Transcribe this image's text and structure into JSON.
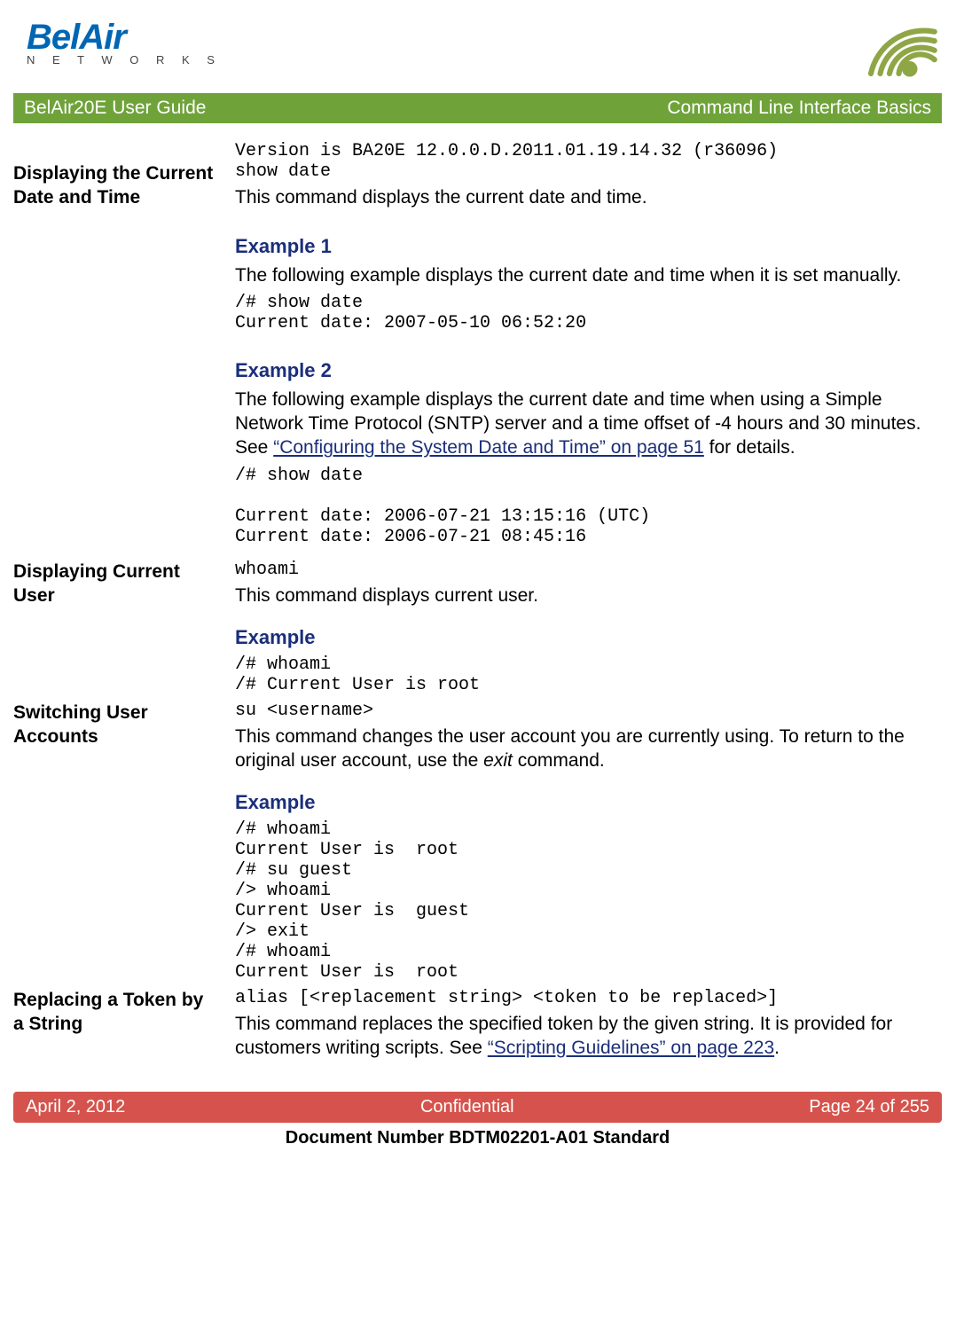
{
  "header": {
    "logo_top": "BelAir",
    "logo_bottom": "N E T W O R K S"
  },
  "titlebar": {
    "left": "BelAir20E User Guide",
    "right": "Command Line Interface Basics"
  },
  "version_line": "Version is BA20E 12.0.0.D.2011.01.19.14.32 (r36096)",
  "sections": {
    "datetime": {
      "side": "Displaying the Current Date and Time",
      "cmd": "show date",
      "desc": "This command displays the current date and time.",
      "ex1_title": "Example 1",
      "ex1_desc": "The following example displays the current date and time when it is set manually.",
      "ex1_code": "/# show date\nCurrent date: 2007-05-10 06:52:20",
      "ex2_title": "Example 2",
      "ex2_desc_pre": "The following example displays the current date and time when using a Simple Network Time Protocol (SNTP) server and a time offset of -4 hours and 30 minutes. See ",
      "ex2_link": "“Configuring the System Date and Time” on page 51",
      "ex2_desc_post": " for details.",
      "ex2_code": "/# show date\n\nCurrent date: 2006-07-21 13:15:16 (UTC)\nCurrent date: 2006-07-21 08:45:16"
    },
    "user": {
      "side": "Displaying Current User",
      "cmd": "whoami",
      "desc": "This command displays current user.",
      "ex_title": "Example",
      "ex_code": "/# whoami\n/# Current User is root"
    },
    "switch": {
      "side": "Switching User Accounts",
      "cmd": "su <username>",
      "desc_pre": "This command changes the user account you are currently using. To return to the original user account, use the ",
      "desc_italic": "exit",
      "desc_post": " command.",
      "ex_title": "Example",
      "ex_code": "/# whoami\nCurrent User is  root\n/# su guest\n/> whoami\nCurrent User is  guest\n/> exit\n/# whoami\nCurrent User is  root"
    },
    "alias": {
      "side": "Replacing a Token by a String",
      "cmd": "alias [<replacement string> <token to be replaced>]",
      "desc_pre": "This command replaces the specified token by the given string. It is provided for customers writing scripts. See ",
      "desc_link": "“Scripting Guidelines” on page 223",
      "desc_post": "."
    }
  },
  "footer": {
    "left": "April 2, 2012",
    "center": "Confidential",
    "right": "Page 24 of 255",
    "docnum": "Document Number BDTM02201-A01 Standard"
  }
}
